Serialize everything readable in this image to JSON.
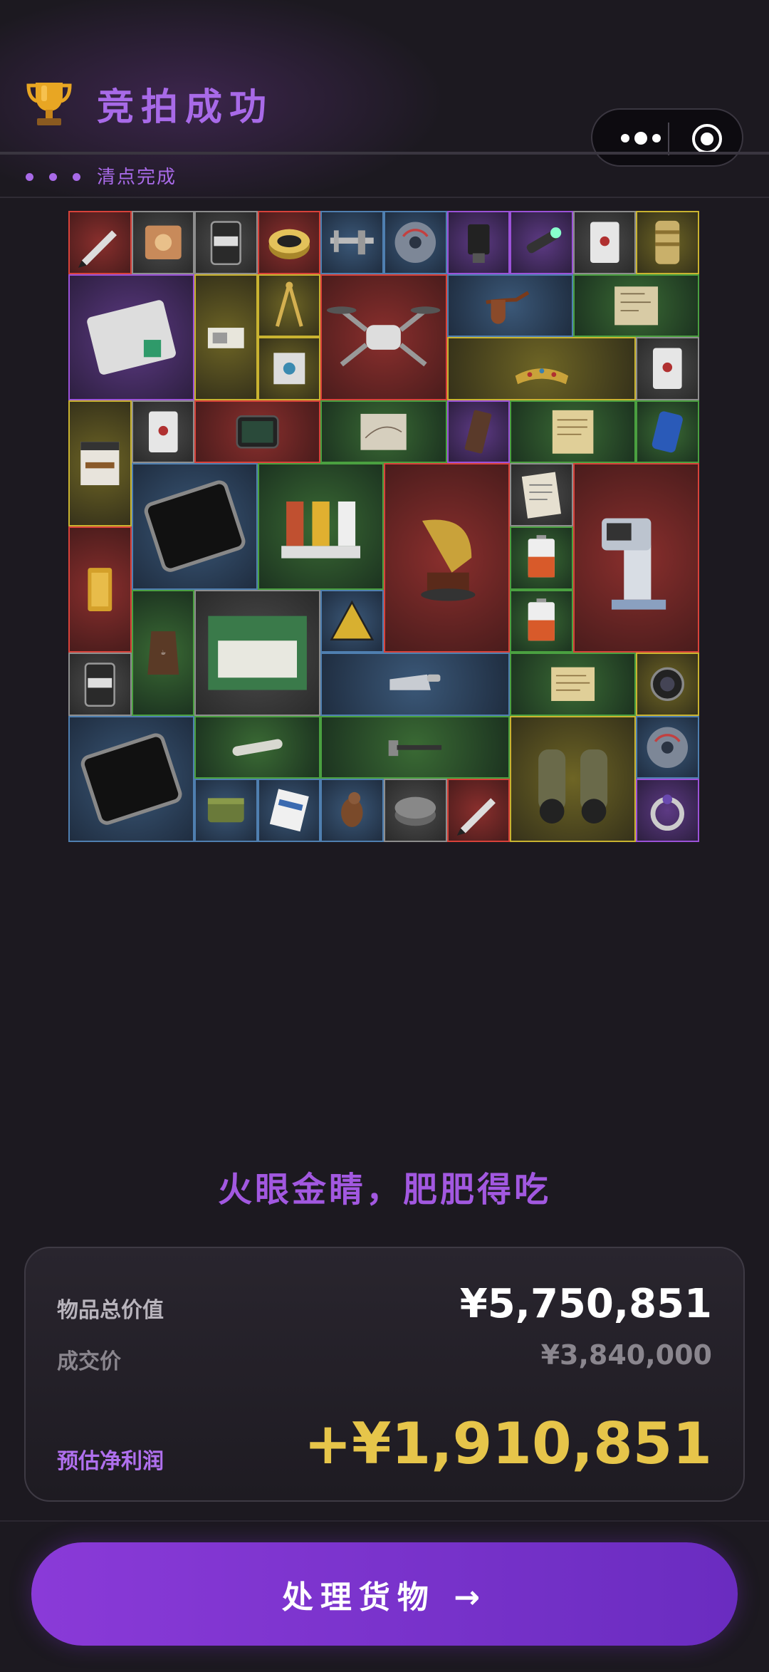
{
  "header": {
    "title": "竞拍成功",
    "trophy_icon": "trophy-icon"
  },
  "status": {
    "text": "清点完成"
  },
  "capsule": {
    "more_icon": "more-dots-icon",
    "close_icon": "target-close-icon"
  },
  "loot_grid": {
    "columns": 10,
    "items": [
      {
        "icon": "pen-icon",
        "rarity": "red"
      },
      {
        "icon": "snack-bag-icon",
        "rarity": "gray"
      },
      {
        "icon": "protein-can-icon",
        "rarity": "gray"
      },
      {
        "icon": "caviar-tin-icon",
        "rarity": "red"
      },
      {
        "icon": "caliper-icon",
        "rarity": "blue"
      },
      {
        "icon": "disc-icon",
        "rarity": "blue"
      },
      {
        "icon": "phone-mount-icon",
        "rarity": "purple"
      },
      {
        "icon": "flashlight-icon",
        "rarity": "purple"
      },
      {
        "icon": "playing-card-icon",
        "rarity": "gray"
      },
      {
        "icon": "cylinder-part-icon",
        "rarity": "yellow"
      },
      {
        "icon": "hard-drive-icon",
        "rarity": "purple"
      },
      {
        "icon": "blueprint-card-icon",
        "rarity": "yellow"
      },
      {
        "icon": "compass-tool-icon",
        "rarity": "yellow"
      },
      {
        "icon": "drone-icon",
        "rarity": "red"
      },
      {
        "icon": "pipe-icon",
        "rarity": "blue"
      },
      {
        "icon": "blueprint-icon",
        "rarity": "green"
      },
      {
        "icon": "cpu-chip-icon",
        "rarity": "yellow"
      },
      {
        "icon": "tiara-icon",
        "rarity": "yellow"
      },
      {
        "icon": "playing-card-icon",
        "rarity": "gray"
      },
      {
        "icon": "coffee-box-icon",
        "rarity": "yellow"
      },
      {
        "icon": "playing-card-icon",
        "rarity": "gray"
      },
      {
        "icon": "tablet-device-icon",
        "rarity": "red"
      },
      {
        "icon": "old-map-icon",
        "rarity": "green"
      },
      {
        "icon": "energy-bar-icon",
        "rarity": "purple"
      },
      {
        "icon": "parchment-icon",
        "rarity": "green"
      },
      {
        "icon": "soda-can-icon",
        "rarity": "green"
      },
      {
        "icon": "tablet-icon",
        "rarity": "blue"
      },
      {
        "icon": "spice-rack-icon",
        "rarity": "green"
      },
      {
        "icon": "gramophone-icon",
        "rarity": "red"
      },
      {
        "icon": "note-paper-icon",
        "rarity": "gray"
      },
      {
        "icon": "robot-arm-icon",
        "rarity": "red"
      },
      {
        "icon": "gold-bar-icon",
        "rarity": "red"
      },
      {
        "icon": "battery-icon",
        "rarity": "green"
      },
      {
        "icon": "battery-icon",
        "rarity": "green"
      },
      {
        "icon": "coffee-bag-icon",
        "rarity": "green"
      },
      {
        "icon": "candle-box-icon",
        "rarity": "gray"
      },
      {
        "icon": "warning-sign-icon",
        "rarity": "blue"
      },
      {
        "icon": "protein-can-icon",
        "rarity": "gray"
      },
      {
        "icon": "saw-icon",
        "rarity": "blue"
      },
      {
        "icon": "document-icon",
        "rarity": "green"
      },
      {
        "icon": "lens-icon",
        "rarity": "yellow"
      },
      {
        "icon": "tablet-icon",
        "rarity": "blue"
      },
      {
        "icon": "tube-icon",
        "rarity": "green"
      },
      {
        "icon": "hammer-icon",
        "rarity": "green"
      },
      {
        "icon": "binoculars-icon",
        "rarity": "yellow"
      },
      {
        "icon": "disc-icon",
        "rarity": "blue"
      },
      {
        "icon": "ammo-can-icon",
        "rarity": "blue"
      },
      {
        "icon": "pill-box-icon",
        "rarity": "blue"
      },
      {
        "icon": "bird-figurine-icon",
        "rarity": "blue"
      },
      {
        "icon": "stone-wheel-icon",
        "rarity": "gray"
      },
      {
        "icon": "pen-icon",
        "rarity": "red"
      },
      {
        "icon": "ring-icon",
        "rarity": "purple"
      }
    ]
  },
  "slogan": "火眼金睛，肥肥得吃",
  "summary": {
    "total_label": "物品总价值",
    "total_value": "¥5,750,851",
    "deal_label": "成交价",
    "deal_value": "¥3,840,000",
    "profit_label": "预估净利润",
    "profit_value": "+¥1,910,851"
  },
  "cta": {
    "label": "处理货物 →"
  },
  "colors": {
    "accent": "#a86ae8",
    "gold": "#e6c54a",
    "button": "#7a34cc",
    "background": "#1c1920"
  }
}
